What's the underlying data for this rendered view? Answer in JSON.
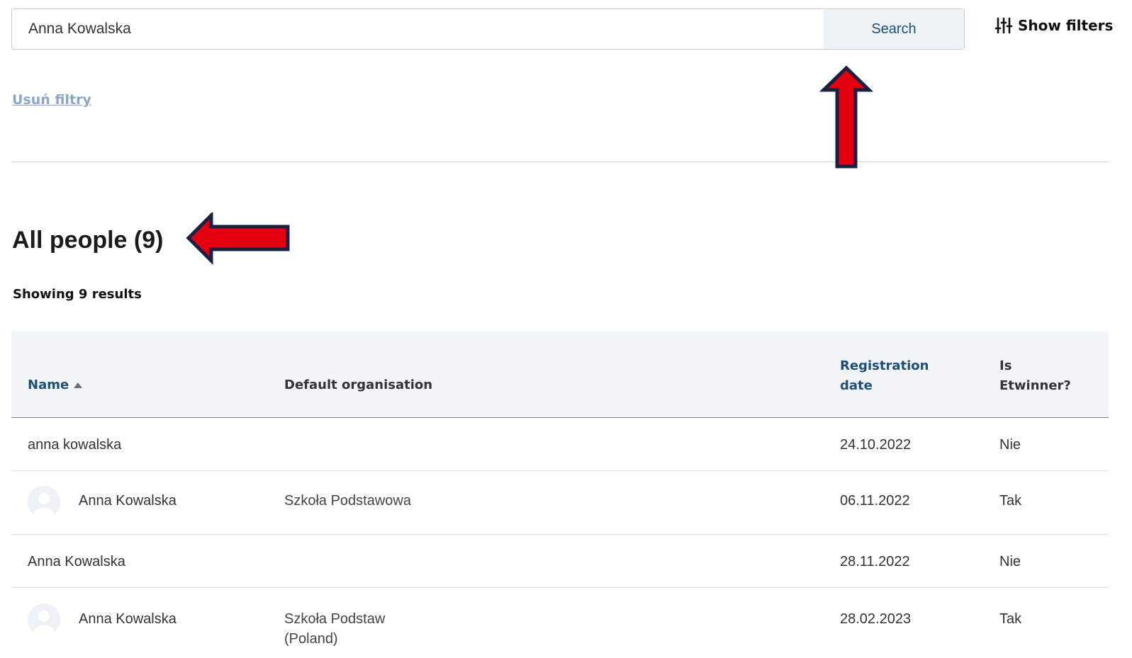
{
  "search": {
    "value": "Anna Kowalska",
    "button_label": "Search"
  },
  "filters": {
    "show_label": "Show filters",
    "clear_label": "Usuń filtry"
  },
  "heading": {
    "title": "All people (9)",
    "results_text": "Showing 9 results"
  },
  "table": {
    "columns": {
      "name": "Name",
      "org": "Default organisation",
      "reg_line1": "Registration",
      "reg_line2": "date",
      "etw_line1": "Is",
      "etw_line2": "Etwinner?"
    },
    "rows": [
      {
        "name": "anna kowalska",
        "org": "",
        "org2": "",
        "date": "24.10.2022",
        "etwinner": "Nie"
      },
      {
        "name": "Anna Kowalska",
        "org": "Szkoła Podstawowa",
        "org2": "",
        "date": "06.11.2022",
        "etwinner": "Tak"
      },
      {
        "name": "Anna Kowalska",
        "org": "",
        "org2": "",
        "date": "28.11.2022",
        "etwinner": "Nie"
      },
      {
        "name": "Anna Kowalska",
        "org": "Szkoła Podstaw",
        "org2": "(Poland)",
        "date": "28.02.2023",
        "etwinner": "Tak"
      }
    ]
  },
  "colors": {
    "accent": "#1f4e79",
    "arrow_fill": "#e3000f",
    "arrow_outline": "#1a2040",
    "link": "#8ba7c7",
    "header_bg": "#f2f5f8"
  },
  "icons": {
    "filters": "sliders-icon",
    "sort": "sort-asc-icon",
    "avatar": "user-avatar-icon",
    "annotation_up": "red-arrow-up",
    "annotation_left": "red-arrow-left"
  }
}
